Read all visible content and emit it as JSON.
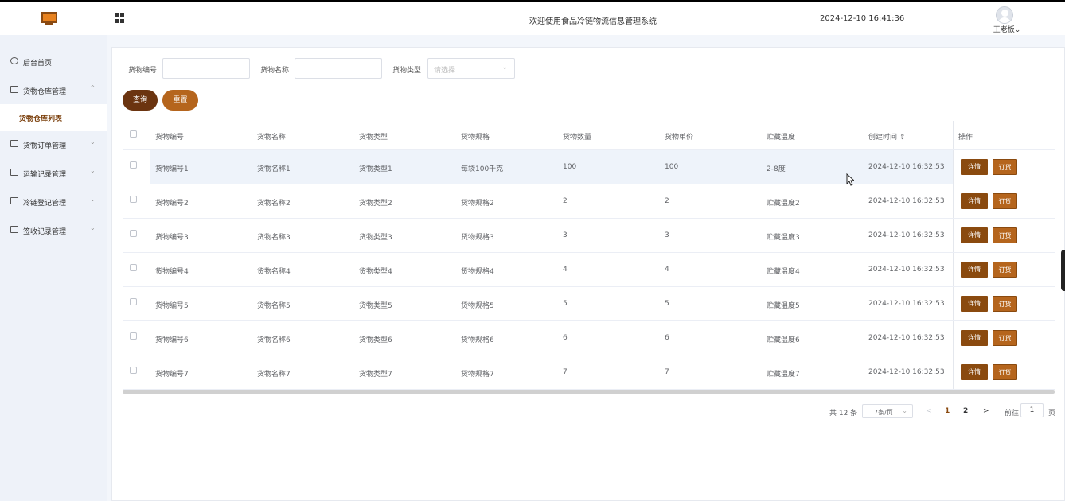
{
  "header": {
    "welcome": "欢迎使用食品冷链物流信息管理系统",
    "datetime": "2024-12-10 16:41:36",
    "user": "王老板"
  },
  "sidebar": {
    "items": [
      {
        "label": "后台首页",
        "icon": "clock-icon",
        "arrow": ""
      },
      {
        "label": "货物仓库管理",
        "icon": "menu-icon",
        "arrow": "^"
      },
      {
        "label": "货物仓库列表",
        "sub": true
      },
      {
        "label": "货物订单管理",
        "icon": "menu-icon",
        "arrow": "⌄"
      },
      {
        "label": "运输记录管理",
        "icon": "menu-icon",
        "arrow": "⌄"
      },
      {
        "label": "冷链登记管理",
        "icon": "menu-icon",
        "arrow": "⌄"
      },
      {
        "label": "签收记录管理",
        "icon": "menu-icon",
        "arrow": "⌄"
      }
    ]
  },
  "filters": {
    "code_label": "货物编号",
    "name_label": "货物名称",
    "type_label": "货物类型",
    "type_placeholder": "请选择",
    "search_button": "查询",
    "reset_button": "重置"
  },
  "table": {
    "columns": [
      "货物编号",
      "货物名称",
      "货物类型",
      "货物规格",
      "货物数量",
      "货物单价",
      "贮藏温度",
      "创建时间 ⇕",
      "操作"
    ],
    "rows": [
      [
        "货物编号1",
        "货物名称1",
        "货物类型1",
        "每袋100千克",
        "100",
        "100",
        "2-8度",
        "2024-12-10 16:32:53"
      ],
      [
        "货物编号2",
        "货物名称2",
        "货物类型2",
        "货物规格2",
        "2",
        "2",
        "贮藏温度2",
        "2024-12-10 16:32:53"
      ],
      [
        "货物编号3",
        "货物名称3",
        "货物类型3",
        "货物规格3",
        "3",
        "3",
        "贮藏温度3",
        "2024-12-10 16:32:53"
      ],
      [
        "货物编号4",
        "货物名称4",
        "货物类型4",
        "货物规格4",
        "4",
        "4",
        "贮藏温度4",
        "2024-12-10 16:32:53"
      ],
      [
        "货物编号5",
        "货物名称5",
        "货物类型5",
        "货物规格5",
        "5",
        "5",
        "贮藏温度5",
        "2024-12-10 16:32:53"
      ],
      [
        "货物编号6",
        "货物名称6",
        "货物类型6",
        "货物规格6",
        "6",
        "6",
        "贮藏温度6",
        "2024-12-10 16:32:53"
      ],
      [
        "货物编号7",
        "货物名称7",
        "货物类型7",
        "货物规格7",
        "7",
        "7",
        "贮藏温度7",
        "2024-12-10 16:32:53"
      ]
    ],
    "detail_button": "详情",
    "order_button": "订货"
  },
  "pagination": {
    "total": "共 12 条",
    "page_size": "7条/页",
    "prev": "<",
    "pages": [
      "1",
      "2"
    ],
    "next": ">",
    "goto_label": "前往",
    "goto_value": "1",
    "goto_suffix": "页"
  },
  "colors": {
    "primary_dark": "#8a4a0f",
    "primary": "#b5651d",
    "search_button": "#6b3410"
  }
}
